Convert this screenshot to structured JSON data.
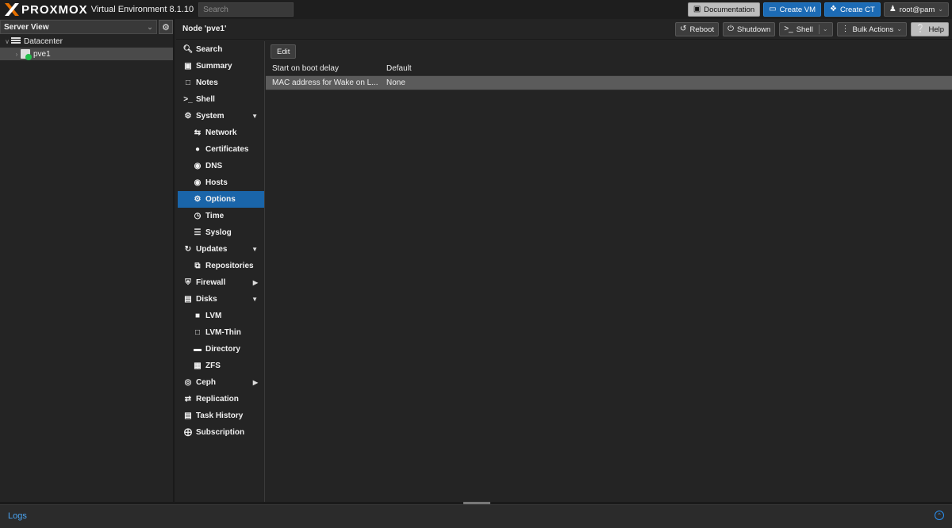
{
  "header": {
    "brand_x": "X",
    "brand_text": "PROXMOX",
    "product": "Virtual Environment 8.1.10",
    "search_placeholder": "Search",
    "buttons": {
      "documentation": "Documentation",
      "create_vm": "Create VM",
      "create_ct": "Create CT",
      "user": "root@pam"
    },
    "accent_orange": "#e57000",
    "accent_blue": "#1c6bb5"
  },
  "tree": {
    "view_label": "Server View",
    "datacenter": "Datacenter",
    "node": "pve1",
    "node_status_color": "#21bf4b"
  },
  "content": {
    "title": "Node 'pve1'",
    "buttons": {
      "reboot": "Reboot",
      "shutdown": "Shutdown",
      "shell": "Shell",
      "bulk_actions": "Bulk Actions",
      "help": "Help"
    }
  },
  "menu": {
    "items": [
      {
        "label": "Search",
        "icon": "search-icon"
      },
      {
        "label": "Summary",
        "icon": "book-icon"
      },
      {
        "label": "Notes",
        "icon": "notes-icon"
      },
      {
        "label": "Shell",
        "icon": "terminal-icon"
      },
      {
        "label": "System",
        "icon": "cogs-icon"
      },
      {
        "label": "Network",
        "icon": "exchange-icon"
      },
      {
        "label": "Certificates",
        "icon": "certificate-icon"
      },
      {
        "label": "DNS",
        "icon": "globe-icon"
      },
      {
        "label": "Hosts",
        "icon": "globe-icon"
      },
      {
        "label": "Options",
        "icon": "gear-icon"
      },
      {
        "label": "Time",
        "icon": "clock-icon"
      },
      {
        "label": "Syslog",
        "icon": "list-icon"
      },
      {
        "label": "Updates",
        "icon": "refresh-icon"
      },
      {
        "label": "Repositories",
        "icon": "files-icon"
      },
      {
        "label": "Firewall",
        "icon": "shield-icon"
      },
      {
        "label": "Disks",
        "icon": "hdd-icon"
      },
      {
        "label": "LVM",
        "icon": "square-icon"
      },
      {
        "label": "LVM-Thin",
        "icon": "square-outline-icon"
      },
      {
        "label": "Directory",
        "icon": "folder-icon"
      },
      {
        "label": "ZFS",
        "icon": "th-large-icon"
      },
      {
        "label": "Ceph",
        "icon": "ceph-icon"
      },
      {
        "label": "Replication",
        "icon": "retweet-icon"
      },
      {
        "label": "Task History",
        "icon": "list-alt-icon"
      },
      {
        "label": "Subscription",
        "icon": "support-icon"
      }
    ],
    "active": "Options"
  },
  "options_grid": {
    "edit_label": "Edit",
    "rows": [
      {
        "key": "Start on boot delay",
        "value": "Default"
      },
      {
        "key": "MAC address for Wake on L...",
        "value": "None"
      }
    ]
  },
  "logs": {
    "title": "Logs"
  }
}
